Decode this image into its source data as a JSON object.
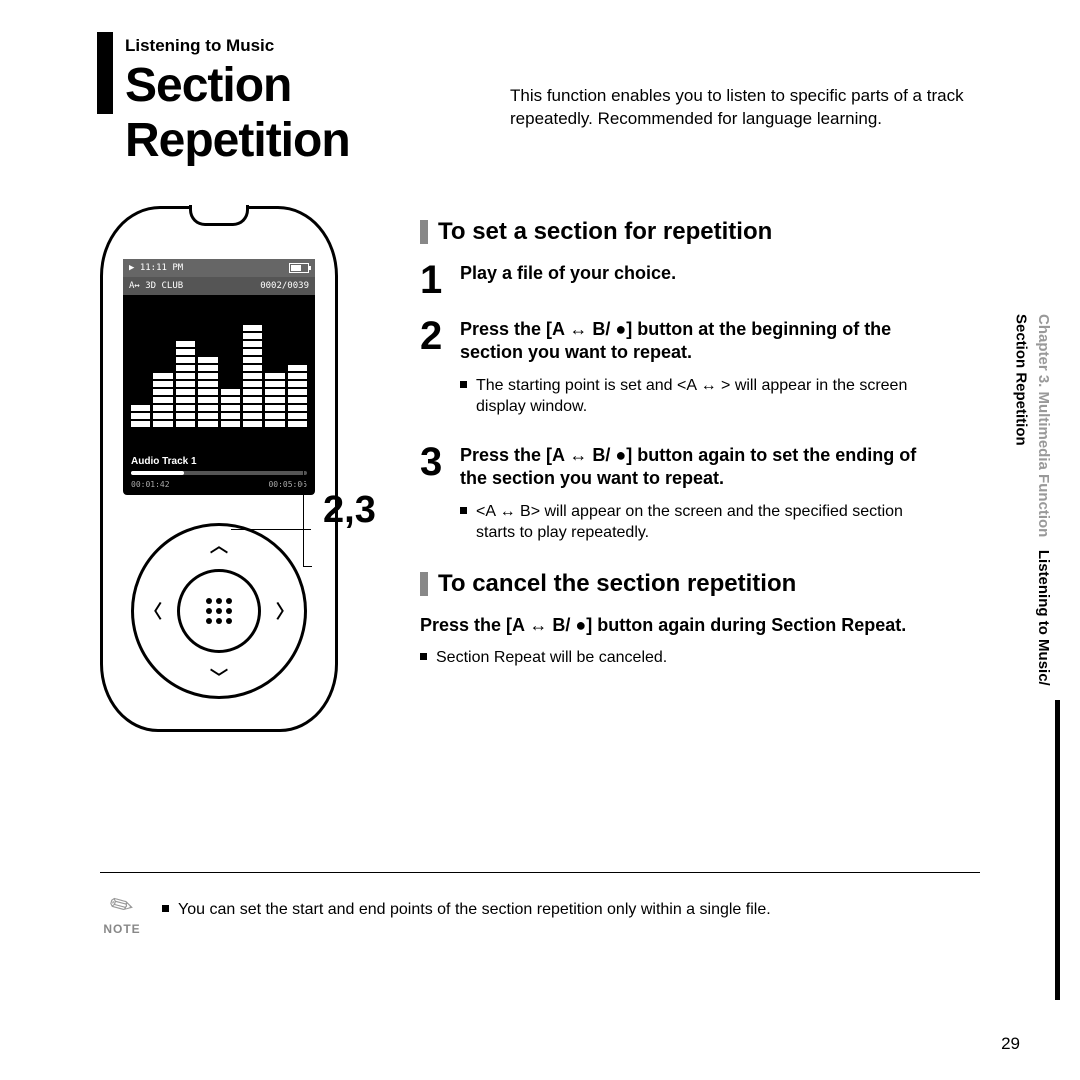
{
  "header": {
    "breadcrumb": "Listening to Music",
    "title": "Section Repetition",
    "description": "This function enables you to listen to specific parts of a track repeatedly. Recommended for language learning."
  },
  "device": {
    "status_time": "▶ 11:11 PM",
    "status_mode": "A↔ 3D CLUB",
    "status_count": "0002/0039",
    "track_label": "Audio Track 1",
    "time_elapsed": "00:01:42",
    "time_total": "00:05:06",
    "callout_label": "2,3"
  },
  "sections": {
    "set": {
      "heading": "To set a section for repetition",
      "steps": [
        {
          "num": "1",
          "title": "Play a file of your choice."
        },
        {
          "num": "2",
          "title": "Press the [A ↔ B/ ●] button at the beginning of the section you want to repeat.",
          "bullets": [
            "The starting point is set and <A ↔ > will appear in the screen display window."
          ]
        },
        {
          "num": "3",
          "title": "Press the [A ↔ B/ ●] button again to set the ending of the section you want to repeat.",
          "bullets": [
            "<A ↔ B> will appear on the screen and the specified section starts to play repeatedly."
          ]
        }
      ]
    },
    "cancel": {
      "heading": "To cancel the section repetition",
      "title": "Press the [A ↔ B/ ●] button again during Section Repeat.",
      "bullets": [
        "Section Repeat will be canceled."
      ]
    }
  },
  "side": {
    "chapter": "Chapter 3. Multimedia Function",
    "sub1": "Listening to Music/",
    "sub2": "Section Repetition"
  },
  "note": {
    "label": "NOTE",
    "text": "You can set the start and end points of the section repetition only within a single file."
  },
  "page_number": "29"
}
